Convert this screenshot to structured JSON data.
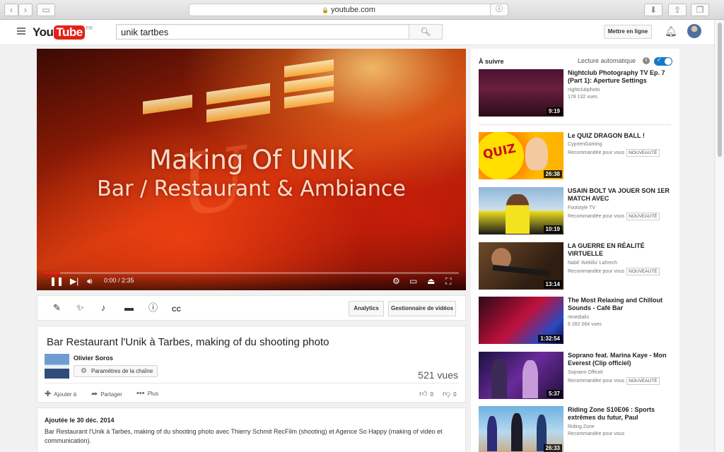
{
  "browser": {
    "url": "youtube.com",
    "back_icon": "chevron-left-icon",
    "forward_icon": "chevron-right-icon"
  },
  "header": {
    "logo_you": "You",
    "logo_tube": "Tube",
    "logo_region": "FR",
    "search_value": "unik tartbes",
    "upload_label": "Mettre en ligne"
  },
  "player": {
    "overlay_line1": "Making Of UNIK",
    "overlay_line2": "Bar / Restaurant & Ambiance",
    "time": "0:00 / 2:35",
    "progress": 0.04
  },
  "actions_bar": {
    "analytics_label": "Analytics",
    "manager_label": "Gestionnaire de vidéos"
  },
  "video": {
    "title": "Bar Restaurant l'Unik à Tarbes, making of du shooting photo",
    "owner": "Olivier Soros",
    "channel_settings_label": "Paramètres de la chaîne",
    "views": "521 vues",
    "add_to_label": "Ajouter à",
    "share_label": "Partager",
    "more_label": "Plus",
    "likes": "0",
    "dislikes": "0"
  },
  "description": {
    "date": "Ajoutée le 30 déc. 2014",
    "text": "Bar Restaurant l'Unik à Tarbes, making of du shooting photo avec Thierry Schmit RecFilm (shooting) et Agence So Happy (making of vidéo et communication)."
  },
  "sidebar": {
    "up_next_label": "À suivre",
    "autoplay_label": "Lecture automatique",
    "autoplay_on": true,
    "items": [
      {
        "title": "Nightclub Photography TV Ep. 7 (Part 1): Aperture Settings",
        "channel": "nightclubphoto",
        "meta": "178 132 vues",
        "badge": "",
        "duration": "9:19"
      },
      {
        "title": "Le QUIZ DRAGON BALL !",
        "channel": "CyprienGaming",
        "meta": "Recommandée pour vous",
        "badge": "NOUVEAUTÉ",
        "duration": "26:38",
        "thumb_text": "QUIZ"
      },
      {
        "title": "USAIN BOLT VA JOUER SON 1ER MATCH AVEC",
        "channel": "Footstyle TV",
        "meta": "Recommandée pour vous",
        "badge": "NOUVEAUTÉ",
        "duration": "10:19"
      },
      {
        "title": "LA GUERRE EN RÉALITÉ VIRTUELLE",
        "channel": "Nabil 'Aiekillu' Lahrech",
        "meta": "Recommandée pour vous",
        "badge": "NOUVEAUTÉ",
        "duration": "13:14"
      },
      {
        "title": "The Most Relaxing and Chillout Sounds - Café Bar",
        "channel": "rtmedialis",
        "meta": "6 282 064 vues",
        "badge": "",
        "duration": "1:32:54"
      },
      {
        "title": "Soprano feat. Marina Kaye - Mon Everest (Clip officiel)",
        "channel": "Soprano Officiel",
        "meta": "Recommandée pour vous",
        "badge": "NOUVEAUTÉ",
        "duration": "5:37"
      },
      {
        "title": "Riding Zone S10E06 : Sports extrêmes du futur, Paul",
        "channel": "Riding Zone",
        "meta": "Recommandée pour vous",
        "badge": "",
        "duration": "26:33"
      }
    ]
  }
}
